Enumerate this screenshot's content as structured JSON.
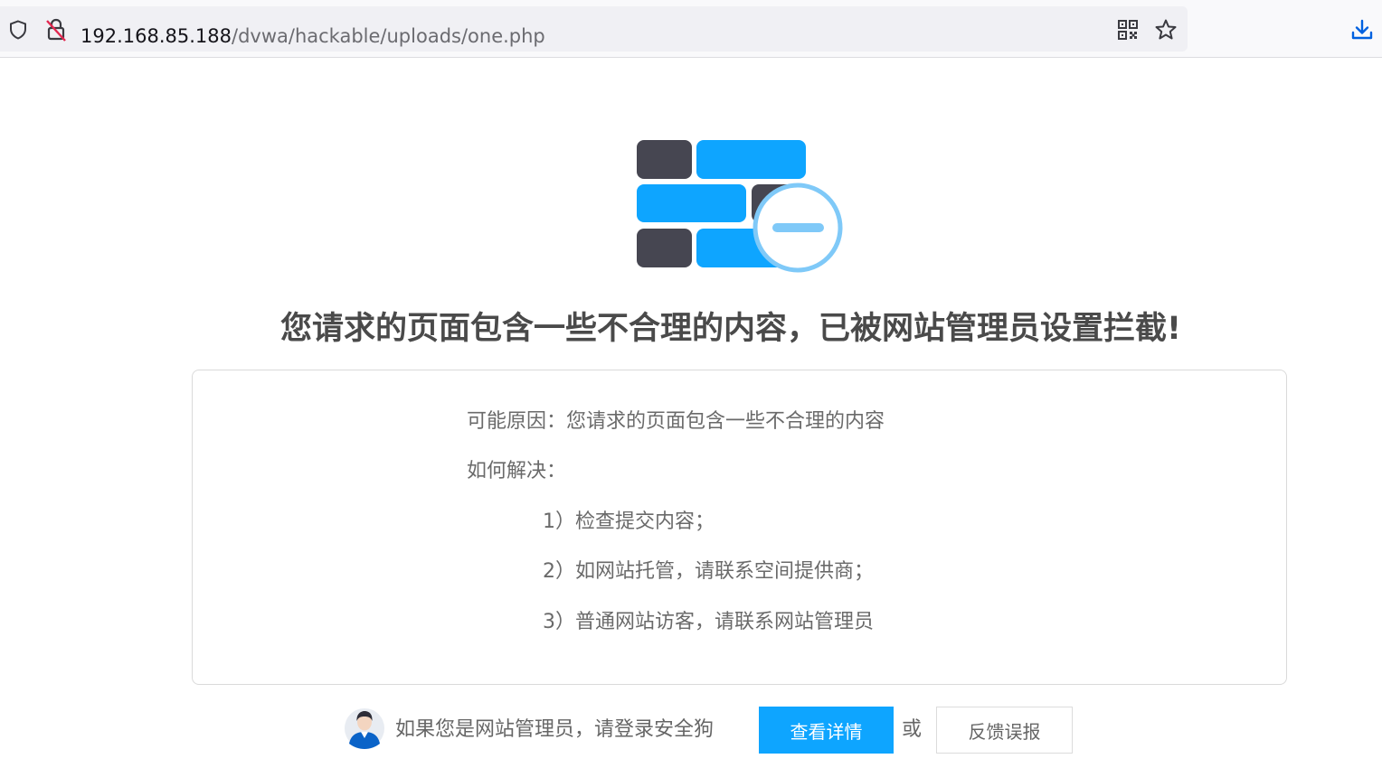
{
  "browser": {
    "url_host": "192.168.85.188",
    "url_path": "/dvwa/hackable/uploads/one.php",
    "icons": [
      "shield-icon",
      "insecure-lock-icon",
      "qr-code-icon",
      "bookmark-star-icon",
      "download-icon"
    ]
  },
  "block_page": {
    "icon": "firewall-block-icon",
    "headline": "您请求的页面包含一些不合理的内容，已被网站管理员设置拦截!",
    "reason": "可能原因：您请求的页面包含一些不合理的内容",
    "solution_label": "如何解决：",
    "solutions": [
      "1）检查提交内容；",
      "2）如网站托管，请联系空间提供商；",
      "3）普通网站访客，请联系网站管理员"
    ],
    "colors": {
      "accent": "#0ea5ff",
      "dark_brick": "#464651",
      "ring": "#7fc9f8"
    }
  },
  "footer": {
    "admin_prompt": "如果您是网站管理员，请登录安全狗",
    "details_button": "查看详情",
    "or_text": "或",
    "feedback_button": "反馈误报"
  }
}
